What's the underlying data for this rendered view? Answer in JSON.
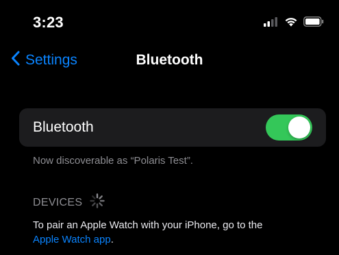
{
  "status_bar": {
    "time": "3:23",
    "icons": [
      "cellular-signal-icon",
      "wifi-icon",
      "battery-icon"
    ]
  },
  "nav": {
    "back_label": "Settings",
    "title": "Bluetooth"
  },
  "bluetooth_row": {
    "label": "Bluetooth",
    "toggle_on": true
  },
  "discoverable_text": "Now discoverable as “Polaris Test”.",
  "devices_section": {
    "header": "DEVICES",
    "loading": true
  },
  "info": {
    "text": "To pair an Apple Watch with your iPhone, go to the",
    "link": "Apple Watch app",
    "suffix": "."
  },
  "colors": {
    "accent": "#0a84ff",
    "toggle_on": "#34c759",
    "background": "#000000",
    "cell": "#1c1c1e",
    "secondary_text": "#8e8e93"
  }
}
